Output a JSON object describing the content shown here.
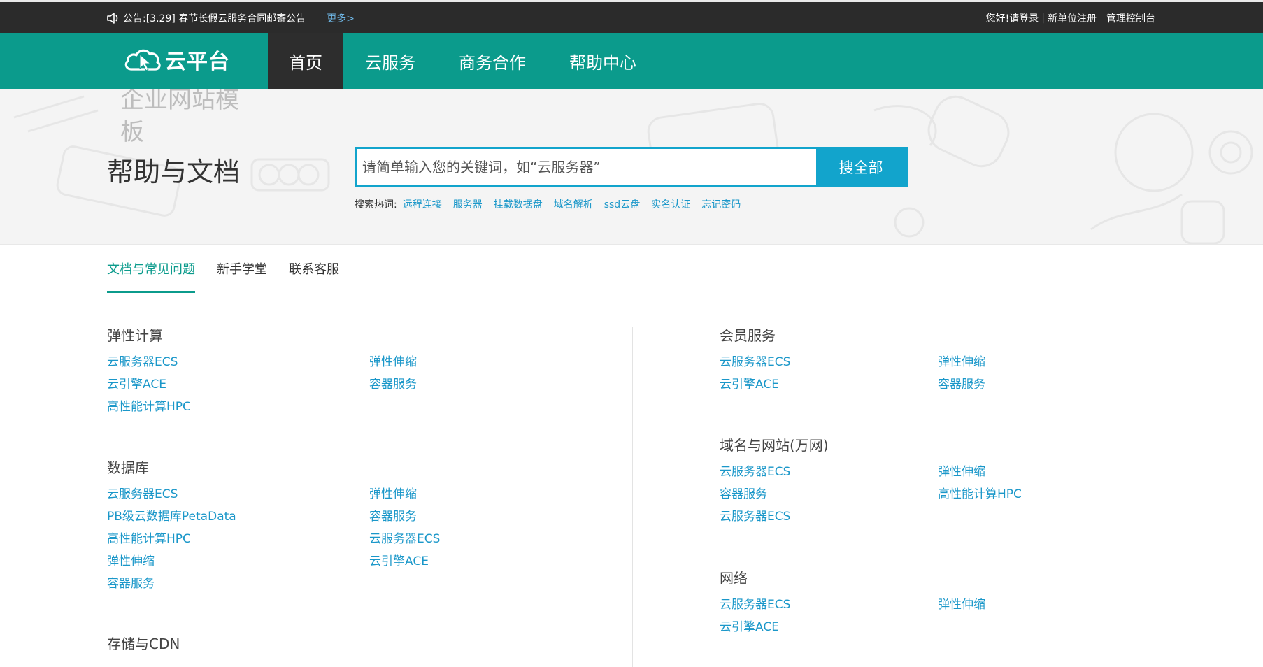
{
  "topbar": {
    "notice_label": "公告:",
    "notice_text": "[3.29] 春节长假云服务合同邮寄公告",
    "more_label": "更多>",
    "greeting": "您好!",
    "login_label": "请登录",
    "register_label": "新单位注册",
    "console_label": "管理控制台"
  },
  "nav": {
    "logo_text": "云平台",
    "items": [
      "首页",
      "云服务",
      "商务合作",
      "帮助中心"
    ]
  },
  "hero": {
    "site_title": "企业网站模板",
    "title": "帮助与文档",
    "search_placeholder": "请简单输入您的关键词，如“云服务器”",
    "search_button": "搜全部",
    "hot_label": "搜索热词:",
    "hot_words": [
      "远程连接",
      "服务器",
      "挂载数据盘",
      "域名解析",
      "ssd云盘",
      "实名认证",
      "忘记密码"
    ]
  },
  "tabs": [
    "文档与常见问题",
    "新手学堂",
    "联系客服"
  ],
  "categories": {
    "elastic": {
      "title": "弹性计算",
      "links": [
        "云服务器ECS",
        "弹性伸缩",
        "云引擎ACE",
        "容器服务",
        "高性能计算HPC"
      ]
    },
    "database": {
      "title": "数据库",
      "links": [
        "云服务器ECS",
        "弹性伸缩",
        "PB级云数据库PetaData",
        "容器服务",
        "高性能计算HPC",
        "云服务器ECS",
        "弹性伸缩",
        "云引擎ACE",
        "容器服务"
      ]
    },
    "storage": {
      "title": "存储与CDN"
    },
    "member": {
      "title": "会员服务",
      "links": [
        "云服务器ECS",
        "弹性伸缩",
        "云引擎ACE",
        "容器服务"
      ]
    },
    "domain": {
      "title": "域名与网站(万网)",
      "links": [
        "云服务器ECS",
        "弹性伸缩",
        "容器服务",
        "高性能计算HPC",
        "云服务器ECS"
      ]
    },
    "network": {
      "title": "网络",
      "links": [
        "云服务器ECS",
        "弹性伸缩",
        "云引擎ACE"
      ]
    }
  },
  "colors": {
    "brand_teal": "#0b9b8c",
    "search_blue": "#12a4cc",
    "link_blue": "#1a97c9",
    "topbar_dark": "#2b2b2b"
  }
}
